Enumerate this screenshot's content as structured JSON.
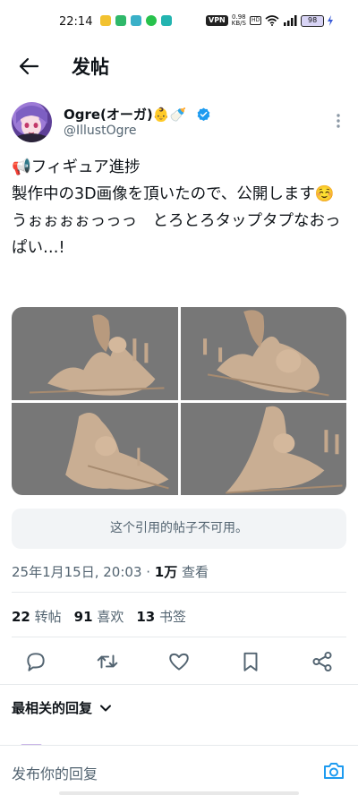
{
  "status_bar": {
    "time": "22:14",
    "vpn": "VPN",
    "speed_value": "0.98",
    "speed_unit": "KB/S",
    "hd": "HD",
    "battery": "98"
  },
  "header": {
    "title": "发帖"
  },
  "author": {
    "name": "Ogre(オーガ)👶🍼",
    "handle": "@IllustOgre"
  },
  "tweet": {
    "text": "📢フィギュア進捗\n製作中の3D画像を頂いたので、公開します☺️\nうぉぉぉぉっっっ　とろとろタップタプなおっぱい…!"
  },
  "quote": {
    "unavailable_text": "这个引用的帖子不可用。"
  },
  "meta": {
    "date_time": "25年1月15日, 20:03 · ",
    "views_num": "1万",
    "views_label": " 查看"
  },
  "stats": {
    "reposts_num": "22",
    "reposts_label": "转帖",
    "likes_num": "91",
    "likes_label": "喜欢",
    "bookmarks_num": "13",
    "bookmarks_label": "书签"
  },
  "replies": {
    "header": "最相关的回复"
  },
  "reply_bar": {
    "placeholder": "发布你的回复"
  },
  "colors": {
    "accent": "#1d9bf0",
    "secondary_text": "#536471",
    "media_bg": "#777777"
  }
}
